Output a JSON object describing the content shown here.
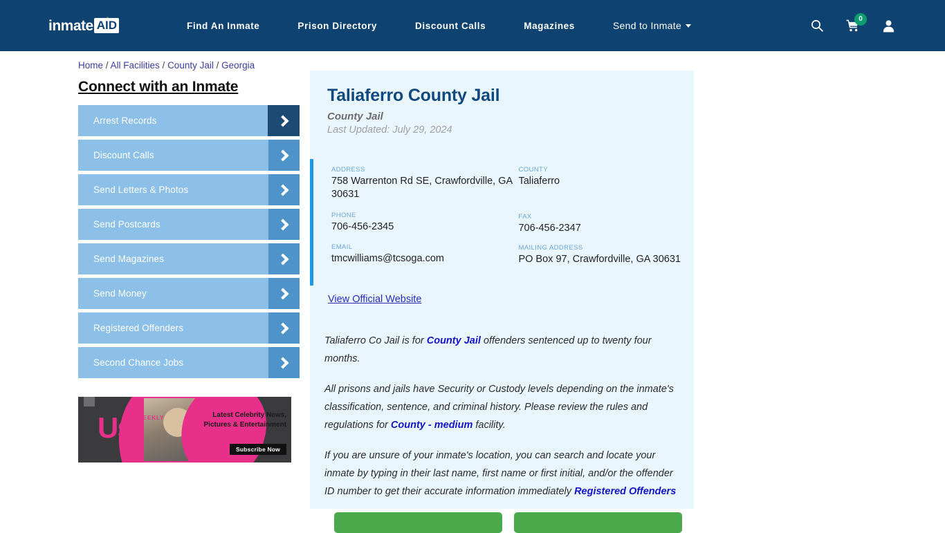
{
  "header": {
    "logo": {
      "word1": "inmate",
      "word2": "AID",
      "cross_icon": "plus-icon",
      "accent_green": "#79b843"
    },
    "nav": [
      {
        "label": "Find An Inmate"
      },
      {
        "label": "Prison Directory"
      },
      {
        "label": "Discount Calls"
      },
      {
        "label": "Magazines"
      },
      {
        "label": "Send to Inmate",
        "has_dropdown": true
      }
    ],
    "icons": [
      {
        "name": "search-icon"
      },
      {
        "name": "cart-icon",
        "badge": "0",
        "badge_color": "#0a9d6e"
      },
      {
        "name": "account-icon"
      }
    ],
    "bg_color": "#0d4271"
  },
  "breadcrumb": {
    "items": [
      "Home",
      "All Facilities",
      "County Jail",
      "Georgia"
    ],
    "separator": "/",
    "link_color": "#3c3c9c"
  },
  "sidebar": {
    "heading": "Connect with an Inmate",
    "items": [
      {
        "label": "Arrest Records",
        "active": true
      },
      {
        "label": "Discount Calls",
        "active": false
      },
      {
        "label": "Send Letters & Photos",
        "active": false
      },
      {
        "label": "Send Postcards",
        "active": false
      },
      {
        "label": "Send Magazines",
        "active": false
      },
      {
        "label": "Send Money",
        "active": false
      },
      {
        "label": "Registered Offenders",
        "active": false
      },
      {
        "label": "Second Chance Jobs",
        "active": false
      }
    ],
    "button_color": "#8cc0e8",
    "arrow_color": "#4e93c9",
    "arrow_active_color": "#1c4a73"
  },
  "ad": {
    "brand": "Us",
    "brand_dots": "WEEKLY",
    "headline": "Latest Celebrity News, Pictures & Entertainment",
    "cta": "Subscribe Now",
    "brand_color": "#e8308a"
  },
  "facility": {
    "name": "Taliaferro County Jail",
    "type": "County Jail",
    "last_updated": "Last Updated: July 29, 2024",
    "accent_bar_color": "#1b9ae8",
    "fields_left": [
      {
        "label": "ADDRESS",
        "value": "758 Warrenton Rd SE, Crawfordville, GA 30631"
      },
      {
        "label": "PHONE",
        "value": "706-456-2345"
      },
      {
        "label": "EMAIL",
        "value": "tmcwilliams@tcsoga.com"
      }
    ],
    "fields_right": [
      {
        "label": "COUNTY",
        "value": "Taliaferro"
      },
      {
        "label": "FAX",
        "value": "706-456-2347"
      },
      {
        "label": "MAILING ADDRESS",
        "value": "PO Box 97, Crawfordville, GA 30631"
      }
    ],
    "website_link": "View Official Website"
  },
  "description": {
    "p1_a": "Taliaferro Co Jail is for ",
    "p1_link": "County Jail",
    "p1_b": " offenders sentenced up to twenty four months.",
    "p2_a": "All prisons and jails have Security or Custody levels depending on the inmate's classification, sentence, and criminal history. Please review the rules and regulations for ",
    "p2_link": "County - medium",
    "p2_b": " facility.",
    "p3_a": "If you are unsure of your inmate's location, you can search and locate your inmate by typing in their last name, first name or first initial, and/or the offender ID number to get their accurate information immediately ",
    "p3_link": "Registered Offenders",
    "link_color": "#1414c8"
  },
  "cta_buttons": [
    {
      "label": "",
      "color": "#49a94b"
    },
    {
      "label": "",
      "color": "#49a94b"
    }
  ]
}
